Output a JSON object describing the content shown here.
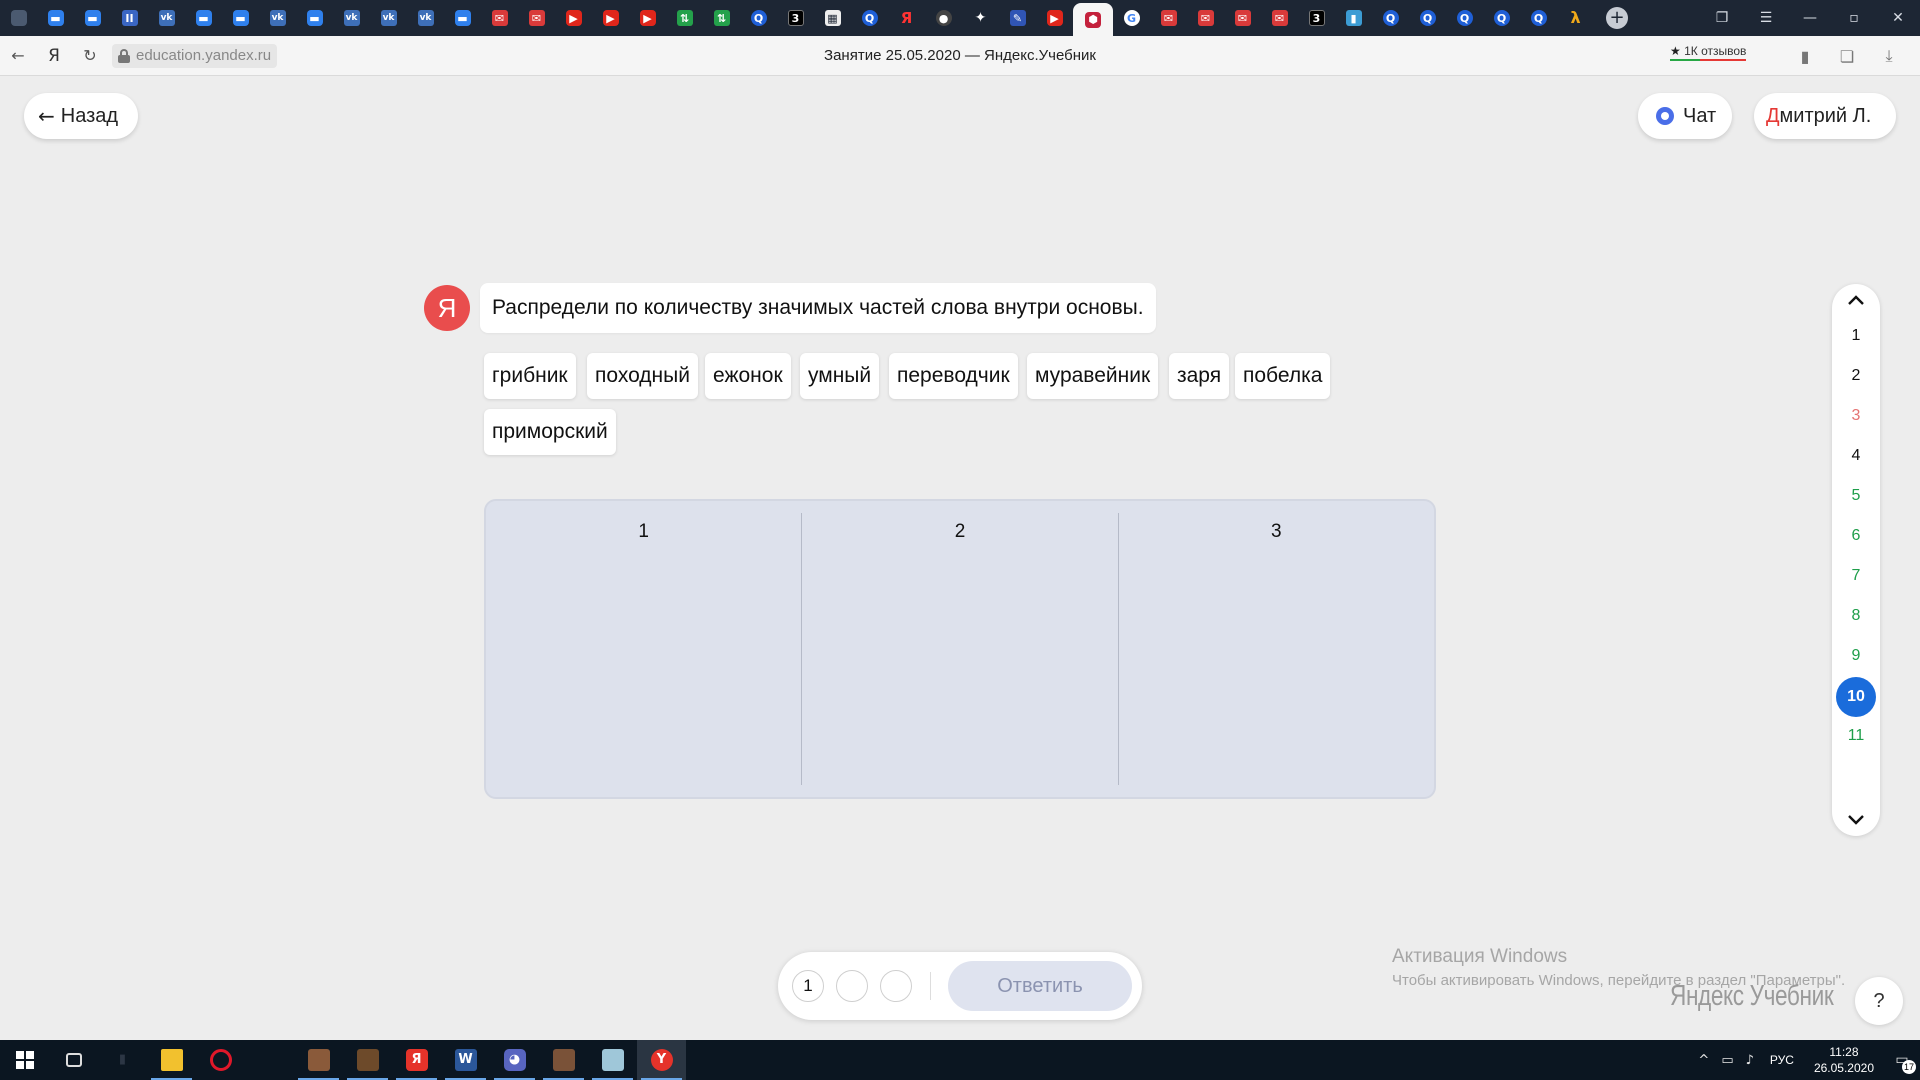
{
  "browser": {
    "tabs": [
      {
        "icon": "tab-favicon",
        "glyph": ""
      },
      {
        "icon": "chat-bubble-icon",
        "glyph": "▬"
      },
      {
        "icon": "chat-bubble-icon",
        "glyph": "▬"
      },
      {
        "icon": "pause-icon",
        "glyph": "II"
      },
      {
        "icon": "vk-icon",
        "glyph": "vk"
      },
      {
        "icon": "chat-bubble-icon",
        "glyph": "▬"
      },
      {
        "icon": "chat-bubble-icon",
        "glyph": "▬"
      },
      {
        "icon": "vk-icon",
        "glyph": "vk"
      },
      {
        "icon": "chat-bubble-icon",
        "glyph": "▬"
      },
      {
        "icon": "vk-icon",
        "glyph": "vk"
      },
      {
        "icon": "vk-icon",
        "glyph": "vk"
      },
      {
        "icon": "vk-icon",
        "glyph": "vk"
      },
      {
        "icon": "chat-bubble-icon",
        "glyph": "▬"
      },
      {
        "icon": "mail-icon",
        "glyph": "✉"
      },
      {
        "icon": "mail-icon",
        "glyph": "✉"
      },
      {
        "icon": "youtube-icon",
        "glyph": "▶"
      },
      {
        "icon": "youtube-icon",
        "glyph": "▶"
      },
      {
        "icon": "youtube-icon",
        "glyph": "▶"
      },
      {
        "icon": "green-app-icon",
        "glyph": "⇅"
      },
      {
        "icon": "green-app-icon",
        "glyph": "⇅"
      },
      {
        "icon": "search-icon",
        "glyph": "Q"
      },
      {
        "icon": "number-three-icon",
        "glyph": "3"
      },
      {
        "icon": "puzzle-icon",
        "glyph": "▦"
      },
      {
        "icon": "search-icon",
        "glyph": "Q"
      },
      {
        "icon": "yandex-icon",
        "glyph": "Я"
      },
      {
        "icon": "camera-icon",
        "glyph": "●"
      },
      {
        "icon": "sparkle-icon",
        "glyph": "✦"
      },
      {
        "icon": "pen-icon",
        "glyph": "✎"
      },
      {
        "icon": "youtube-icon",
        "glyph": "▶"
      },
      {
        "icon": "yandex-education-icon",
        "glyph": "⬢",
        "active": true
      },
      {
        "icon": "google-icon",
        "glyph": "G"
      },
      {
        "icon": "mail-icon",
        "glyph": "✉"
      },
      {
        "icon": "mail-icon",
        "glyph": "✉"
      },
      {
        "icon": "mail-icon",
        "glyph": "✉"
      },
      {
        "icon": "mail-icon",
        "glyph": "✉"
      },
      {
        "icon": "number-three-icon",
        "glyph": "3"
      },
      {
        "icon": "chart-icon",
        "glyph": "▮"
      },
      {
        "icon": "search-icon",
        "glyph": "Q"
      },
      {
        "icon": "search-icon",
        "glyph": "Q"
      },
      {
        "icon": "search-icon",
        "glyph": "Q"
      },
      {
        "icon": "search-icon",
        "glyph": "Q"
      },
      {
        "icon": "search-icon",
        "glyph": "Q"
      },
      {
        "icon": "lambda-icon",
        "glyph": "λ"
      }
    ],
    "url_host": "education.yandex.ru",
    "page_title": "Занятие 25.05.2020 — Яндекс.Учебник",
    "reviews_badge": "1К отзывов",
    "reviews_star": "★"
  },
  "header": {
    "back_label": "Назад",
    "chat_label": "Чат",
    "user_initial": "Д",
    "user_rest": "митрий Л."
  },
  "task": {
    "avatar_letter": "Я",
    "prompt": "Распредели по количеству значимых частей слова внутри основы.",
    "words": [
      "грибник",
      "походный",
      "ежонок",
      "умный",
      "переводчик",
      "муравейник",
      "заря",
      "побелка",
      "приморский"
    ],
    "columns": [
      "1",
      "2",
      "3"
    ]
  },
  "question_nav": {
    "items": [
      {
        "label": "1",
        "status": "default"
      },
      {
        "label": "2",
        "status": "default"
      },
      {
        "label": "3",
        "status": "wrong"
      },
      {
        "label": "4",
        "status": "default"
      },
      {
        "label": "5",
        "status": "correct"
      },
      {
        "label": "6",
        "status": "correct"
      },
      {
        "label": "7",
        "status": "correct"
      },
      {
        "label": "8",
        "status": "correct"
      },
      {
        "label": "9",
        "status": "correct"
      },
      {
        "label": "10",
        "status": "current"
      },
      {
        "label": "11",
        "status": "correct"
      }
    ],
    "colors": {
      "default": "#111111",
      "wrong": "#e57373",
      "correct": "#1e9e4a",
      "current": "#1a6cdb"
    }
  },
  "answer_bar": {
    "attempts": [
      "1",
      "",
      ""
    ],
    "submit_label": "Ответить"
  },
  "watermark": {
    "line1": "Активация Windows",
    "line2": "Чтобы активировать Windows, перейдите в раздел \"Параметры\"."
  },
  "brand_logo": "Яндекс Учебник",
  "help_label": "?",
  "taskbar": {
    "lang": "РУС",
    "time": "11:28",
    "date": "26.05.2020",
    "notifications": "17"
  }
}
